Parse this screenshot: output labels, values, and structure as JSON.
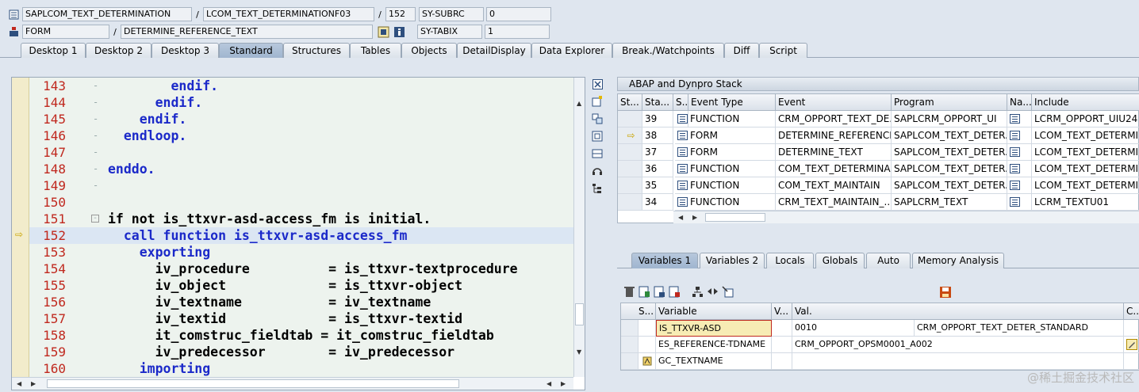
{
  "header": {
    "program": "SAPLCOM_TEXT_DETERMINATION",
    "include": "LCOM_TEXT_DETERMINATIONF03",
    "line": "152",
    "subrc_label": "SY-SUBRC",
    "subrc_value": "0",
    "event_type": "FORM",
    "event_name": "DETERMINE_REFERENCE_TEXT",
    "tabix_label": "SY-TABIX",
    "tabix_value": "1"
  },
  "tabs": [
    "Desktop 1",
    "Desktop 2",
    "Desktop 3",
    "Standard",
    "Structures",
    "Tables",
    "Objects",
    "DetailDisplay",
    "Data Explorer",
    "Break./Watchpoints",
    "Diff",
    "Script"
  ],
  "code": [
    {
      "ln": "143",
      "text": "        endif."
    },
    {
      "ln": "144",
      "text": "      endif."
    },
    {
      "ln": "145",
      "text": "    endif."
    },
    {
      "ln": "146",
      "text": "  endloop."
    },
    {
      "ln": "147",
      "text": ""
    },
    {
      "ln": "148",
      "text": "enddo."
    },
    {
      "ln": "149",
      "text": ""
    },
    {
      "ln": "150",
      "text": ""
    },
    {
      "ln": "151",
      "text": "if not is_ttxvr-asd-access_fm is initial."
    },
    {
      "ln": "152",
      "text": "  call function is_ttxvr-asd-access_fm"
    },
    {
      "ln": "153",
      "text": "    exporting"
    },
    {
      "ln": "154",
      "text": "      iv_procedure          = is_ttxvr-textprocedure"
    },
    {
      "ln": "155",
      "text": "      iv_object             = is_ttxvr-object"
    },
    {
      "ln": "156",
      "text": "      iv_textname           = iv_textname"
    },
    {
      "ln": "157",
      "text": "      iv_textid             = is_ttxvr-textid"
    },
    {
      "ln": "158",
      "text": "      it_comstruc_fieldtab = it_comstruc_fieldtab"
    },
    {
      "ln": "159",
      "text": "      iv_predecessor        = iv_predecessor"
    },
    {
      "ln": "160",
      "text": "    importing"
    }
  ],
  "stack": {
    "title": "ABAP and Dynpro Stack",
    "columns": [
      "St...",
      "Sta...",
      "S...",
      "Event Type",
      "Event",
      "Program",
      "Na...",
      "Include"
    ],
    "rows": [
      {
        "level": "39",
        "type": "FUNCTION",
        "event": "CRM_OPPORT_TEXT_DE...",
        "program": "SAPLCRM_OPPORT_UI",
        "include": "LCRM_OPPORT_UIU24"
      },
      {
        "level": "38",
        "type": "FORM",
        "event": "DETERMINE_REFERENCE...",
        "program": "SAPLCOM_TEXT_DETER...",
        "include": "LCOM_TEXT_DETERMIN"
      },
      {
        "level": "37",
        "type": "FORM",
        "event": "DETERMINE_TEXT",
        "program": "SAPLCOM_TEXT_DETER...",
        "include": "LCOM_TEXT_DETERMIN"
      },
      {
        "level": "36",
        "type": "FUNCTION",
        "event": "COM_TEXT_DETERMINA...",
        "program": "SAPLCOM_TEXT_DETER...",
        "include": "LCOM_TEXT_DETERMIN"
      },
      {
        "level": "35",
        "type": "FUNCTION",
        "event": "COM_TEXT_MAINTAIN",
        "program": "SAPLCOM_TEXT_DETER...",
        "include": "LCOM_TEXT_DETERMIN"
      },
      {
        "level": "34",
        "type": "FUNCTION",
        "event": "CRM_TEXT_MAINTAIN_...",
        "program": "SAPLCRM_TEXT",
        "include": "LCRM_TEXTU01"
      }
    ]
  },
  "var_tabs": [
    "Variables 1",
    "Variables 2",
    "Locals",
    "Globals",
    "Auto",
    "Memory Analysis"
  ],
  "vars": {
    "columns": [
      "S...",
      "Variable",
      "V...",
      "Val.",
      "C..."
    ],
    "rows": [
      {
        "name": "IS_TTXVR-ASD",
        "val1": "0010",
        "val2": "CRM_OPPORT_TEXT_DETER_STANDARD"
      },
      {
        "name": "ES_REFERENCE-TDNAME",
        "val1": "CRM_OPPORT_OPSM0001_A002",
        "val2": ""
      },
      {
        "name": "GC_TEXTNAME",
        "val1": "",
        "val2": ""
      }
    ]
  },
  "watermark": "@稀土掘金技术社区"
}
